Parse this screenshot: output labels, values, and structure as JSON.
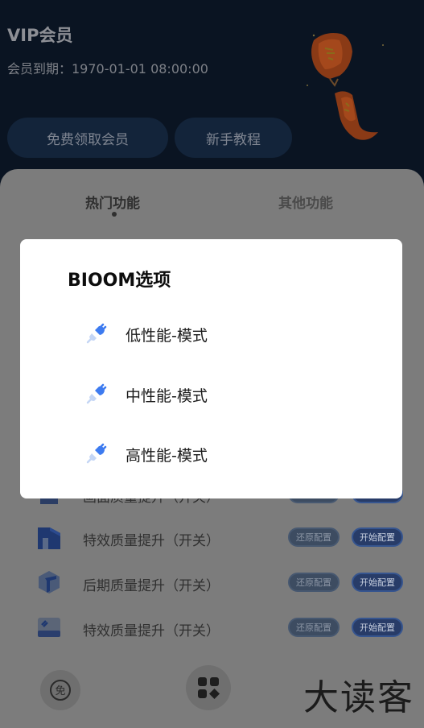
{
  "header": {
    "title": "VIP会员",
    "expire_text": "会员到期：1970-01-01 08:00:00",
    "free_member_button": "免费领取会员",
    "tutorial_button": "新手教程"
  },
  "tabs": {
    "hot": "热门功能",
    "other": "其他功能"
  },
  "rows": [
    {
      "label": "画面质量提升（开关）",
      "restore": "还原配置",
      "start": "开始配置",
      "icon": "building-icon"
    },
    {
      "label": "特效质量提升（开关）",
      "restore": "还原配置",
      "start": "开始配置",
      "icon": "house-icon"
    },
    {
      "label": "后期质量提升（开关）",
      "restore": "还原配置",
      "start": "开始配置",
      "icon": "cube-icon"
    },
    {
      "label": "特效质量提升（开关）",
      "restore": "还原配置",
      "start": "开始配置",
      "icon": "card-icon"
    }
  ],
  "bottom_nav": {
    "free_icon_text": "免",
    "grid_icon": "apps-grid-icon"
  },
  "watermark": "大读客",
  "dialog": {
    "title": "BIOOM选项",
    "options": [
      {
        "label": "低性能-模式",
        "icon": "plug-icon"
      },
      {
        "label": "中性能-模式",
        "icon": "plug-icon"
      },
      {
        "label": "高性能-模式",
        "icon": "plug-icon"
      }
    ]
  },
  "colors": {
    "accent_blue": "#3d7bf0",
    "header_bg": "#0a1422",
    "overlay_sheet": "#7c7c7c"
  }
}
